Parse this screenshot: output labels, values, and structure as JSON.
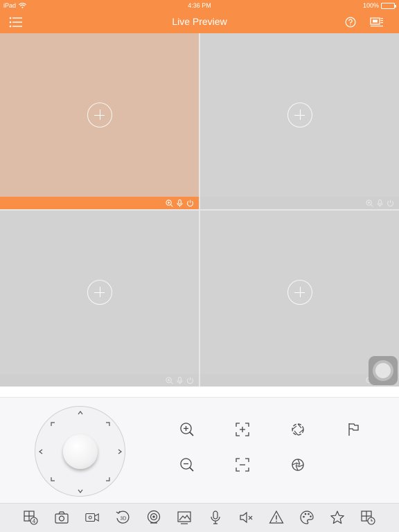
{
  "status_bar": {
    "device": "iPad",
    "time": "4:36 PM",
    "battery": "100%",
    "icons": [
      "wifi-icon",
      "battery-icon"
    ]
  },
  "nav": {
    "title": "Live Preview",
    "left_icon": "menu-list-icon",
    "right_icons": [
      "help-icon",
      "device-list-icon"
    ]
  },
  "colors": {
    "accent": "#f98f46",
    "active_pane": "#ddbda8",
    "inactive_pane": "#d2d2d2",
    "toolbar_bg": "#ececef"
  },
  "grid": {
    "layout": "2x2",
    "active_pane": 1,
    "panes": [
      {
        "index": 1,
        "state": "empty",
        "add_icon": "add-circle-icon",
        "bar_icons": [
          "zoom-icon",
          "microphone-icon",
          "power-icon"
        ]
      },
      {
        "index": 2,
        "state": "empty",
        "add_icon": "add-circle-icon",
        "bar_icons": [
          "zoom-icon",
          "microphone-icon",
          "power-icon"
        ]
      },
      {
        "index": 3,
        "state": "empty",
        "add_icon": "add-circle-icon",
        "bar_icons": [
          "zoom-icon",
          "microphone-icon",
          "power-icon"
        ]
      },
      {
        "index": 4,
        "state": "empty",
        "add_icon": "add-circle-icon",
        "bar_icons": [
          "zoom-icon",
          "microphone-icon",
          "power-icon"
        ]
      }
    ]
  },
  "ptz": {
    "joystick_arrows": [
      "up",
      "up-right",
      "right",
      "down-right",
      "down",
      "down-left",
      "left",
      "up-left"
    ],
    "buttons": [
      "zoom-in-icon",
      "focus-near-icon",
      "iris-open-icon",
      "preset-flag-icon",
      "zoom-out-icon",
      "focus-far-icon",
      "iris-close-icon"
    ]
  },
  "toolbar": {
    "items": [
      "split-screen-icon",
      "snapshot-icon",
      "record-icon",
      "3d-position-icon",
      "fisheye-icon",
      "image-icon",
      "talk-icon",
      "mute-icon",
      "alarm-icon",
      "color-palette-icon",
      "favorite-icon",
      "playback-icon"
    ],
    "split_count": "4",
    "rotate_label": "3D"
  }
}
